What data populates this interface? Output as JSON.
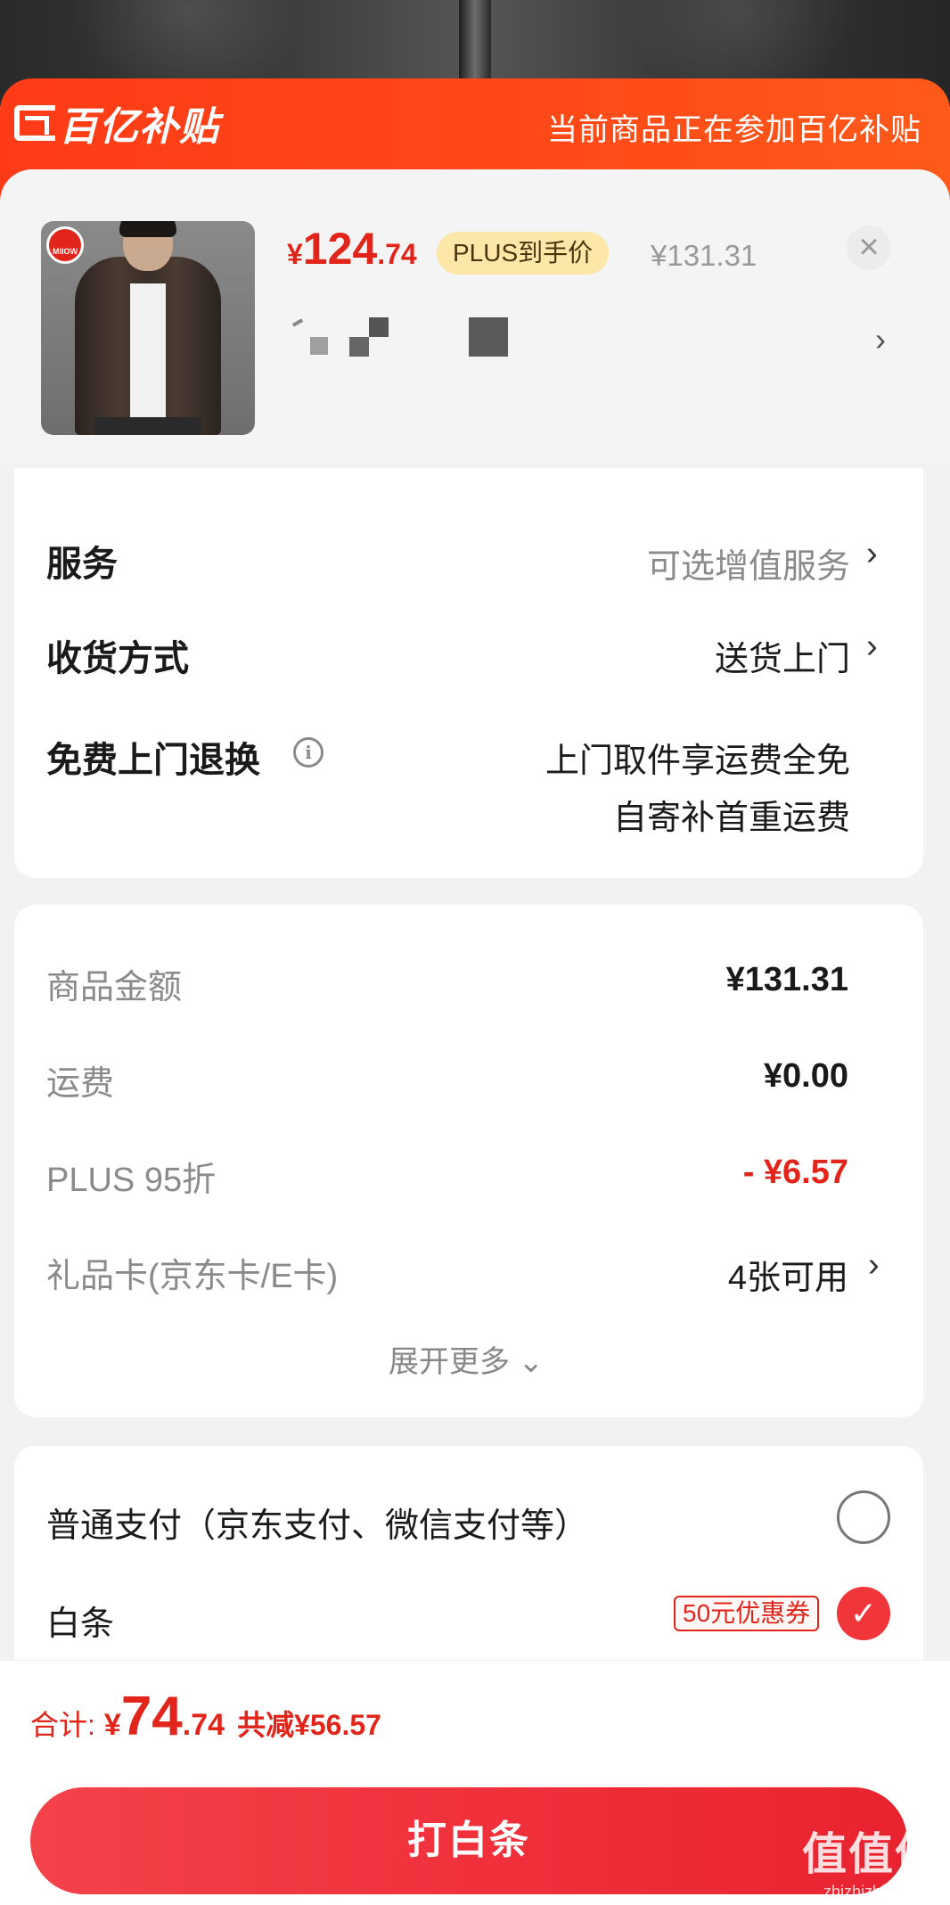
{
  "banner": {
    "logo_text": "百亿补贴",
    "message": "当前商品正在参加百亿补贴"
  },
  "product": {
    "thumb_badge": "MIIOW",
    "price_symbol": "¥",
    "price_int": "124",
    "price_dec": ".74",
    "plus_tag": "PLUS到手价",
    "original_price": "¥131.31",
    "close_icon": "×",
    "spec_arrow": "›"
  },
  "options": {
    "service_label": "服务",
    "service_value": "可选增值服务",
    "delivery_label": "收货方式",
    "delivery_value": "送货上门",
    "return_label": "免费上门退换",
    "return_info_icon": "i",
    "return_line1": "上门取件享运费全免",
    "return_line2": "自寄补首重运费",
    "chevron": "›"
  },
  "summary": {
    "goods_label": "商品金额",
    "goods_value": "¥131.31",
    "shipping_label": "运费",
    "shipping_value": "¥0.00",
    "plus_label": "PLUS 95折",
    "plus_value": "- ¥6.57",
    "giftcard_label": "礼品卡(京东卡/E卡)",
    "giftcard_value": "4张可用",
    "expand_more": "展开更多 ⌄"
  },
  "payment": {
    "normal_label": "普通支付（京东支付、微信支付等）",
    "baitiao_label": "白条",
    "coupon": "50元优惠券",
    "selected": "baitiao"
  },
  "footer": {
    "total_label": "合计:",
    "total_symbol": "¥",
    "total_int": "74",
    "total_dec": ".74",
    "total_saved": "共减¥56.57",
    "pay_button": "打白条",
    "watermark": "值值值",
    "watermark_url": "zhizhizhi.com"
  },
  "colors": {
    "accent_red": "#e1251b",
    "banner_orange": "#ff4a18",
    "pay_button": "#f0313c",
    "plus_gold": "#fde7a8"
  }
}
